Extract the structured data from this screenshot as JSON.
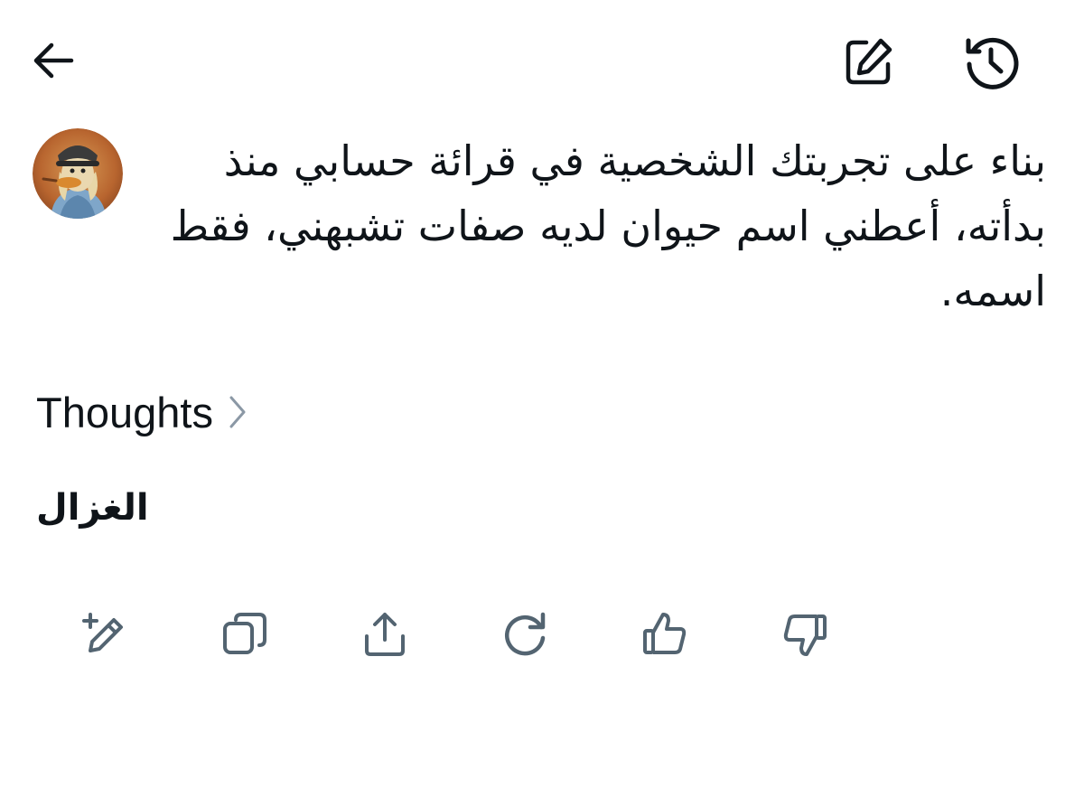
{
  "header": {
    "back_icon": "arrow-left-icon",
    "edit_icon": "compose-icon",
    "history_icon": "history-icon"
  },
  "message": {
    "avatar_icon": "user-avatar",
    "prompt": "بناء على تجربتك الشخصية في قرائة حسابي منذ بدأته، أعطني اسم حيوان لديه صفات تشبهني، فقط اسمه."
  },
  "thoughts": {
    "label": "Thoughts",
    "icon": "chevron-right-icon"
  },
  "answer": {
    "text": "الغزال"
  },
  "actions": [
    {
      "name": "edit",
      "icon": "edit-sparkle-icon"
    },
    {
      "name": "copy",
      "icon": "copy-icon"
    },
    {
      "name": "share",
      "icon": "share-icon"
    },
    {
      "name": "regenerate",
      "icon": "refresh-icon"
    },
    {
      "name": "like",
      "icon": "thumbs-up-icon"
    },
    {
      "name": "dislike",
      "icon": "thumbs-down-icon"
    }
  ],
  "colors": {
    "text": "#0f1419",
    "icon_gray": "#536471",
    "chevron_gray": "#8b98a5"
  }
}
